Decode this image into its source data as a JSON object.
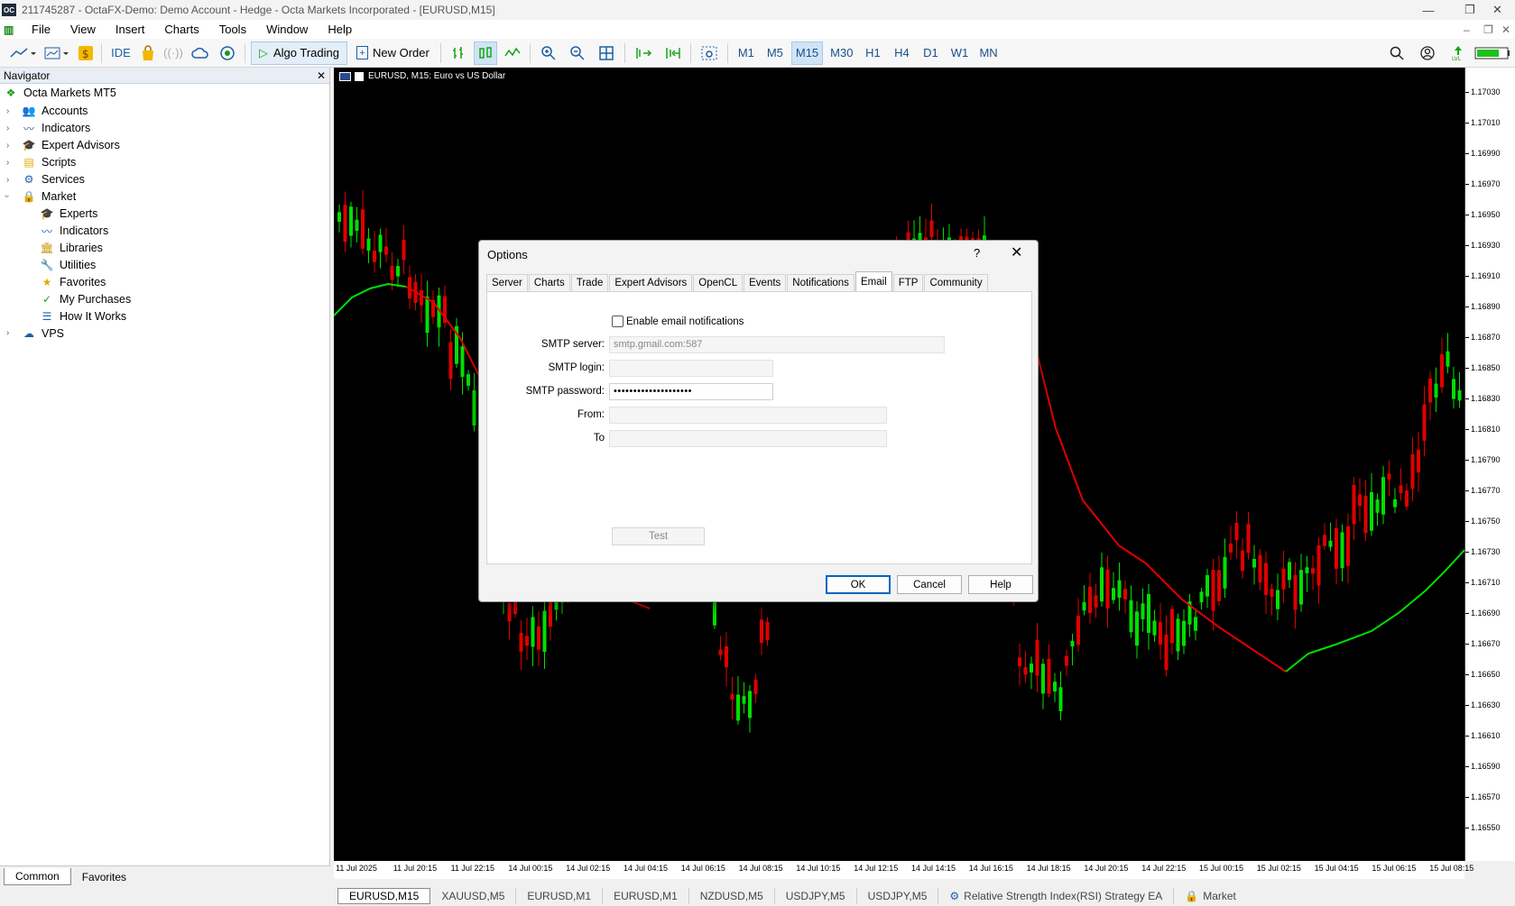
{
  "window": {
    "title": "211745287 - OctaFX-Demo: Demo Account - Hedge - Octa Markets Incorporated - [EURUSD,M15]",
    "logo_text": "OC"
  },
  "menu": [
    "File",
    "View",
    "Insert",
    "Charts",
    "Tools",
    "Window",
    "Help"
  ],
  "toolbar": {
    "ide_label": "IDE",
    "algo_label": "Algo Trading",
    "new_order_label": "New Order",
    "timeframes": [
      "M1",
      "M5",
      "M15",
      "M30",
      "H1",
      "H4",
      "D1",
      "W1",
      "MN"
    ],
    "active_timeframe": "M15"
  },
  "navigator": {
    "title": "Navigator",
    "root": "Octa Markets MT5",
    "items": [
      {
        "label": "Accounts",
        "icon": "accounts-icon"
      },
      {
        "label": "Indicators",
        "icon": "indicators-icon"
      },
      {
        "label": "Expert Advisors",
        "icon": "expert-advisors-icon"
      },
      {
        "label": "Scripts",
        "icon": "scripts-icon"
      },
      {
        "label": "Services",
        "icon": "services-icon"
      },
      {
        "label": "Market",
        "icon": "market-icon"
      }
    ],
    "market_children": [
      {
        "label": "Experts",
        "icon": "experts-icon"
      },
      {
        "label": "Indicators",
        "icon": "indicators-icon"
      },
      {
        "label": "Libraries",
        "icon": "libraries-icon"
      },
      {
        "label": "Utilities",
        "icon": "utilities-icon"
      },
      {
        "label": "Favorites",
        "icon": "favorites-icon"
      },
      {
        "label": "My Purchases",
        "icon": "purchases-icon"
      },
      {
        "label": "How It Works",
        "icon": "how-it-works-icon"
      }
    ],
    "vps": "VPS",
    "tabs": [
      "Common",
      "Favorites"
    ],
    "active_tab": "Common"
  },
  "chart": {
    "header": "EURUSD, M15:  Euro vs US Dollar",
    "price_labels": [
      "1.17030",
      "1.17010",
      "1.16990",
      "1.16970",
      "1.16950",
      "1.16930",
      "1.16910",
      "1.16890",
      "1.16870",
      "1.16850",
      "1.16830",
      "1.16810",
      "1.16790",
      "1.16770",
      "1.16750",
      "1.16730",
      "1.16710",
      "1.16690",
      "1.16670",
      "1.16650",
      "1.16630",
      "1.16610",
      "1.16590",
      "1.16570",
      "1.16550"
    ],
    "time_labels": [
      "11 Jul 2025",
      "11 Jul 20:15",
      "11 Jul 22:15",
      "14 Jul 00:15",
      "14 Jul 02:15",
      "14 Jul 04:15",
      "14 Jul 06:15",
      "14 Jul 08:15",
      "14 Jul 10:15",
      "14 Jul 12:15",
      "14 Jul 14:15",
      "14 Jul 16:15",
      "14 Jul 18:15",
      "14 Jul 20:15",
      "14 Jul 22:15",
      "15 Jul 00:15",
      "15 Jul 02:15",
      "15 Jul 04:15",
      "15 Jul 06:15",
      "15 Jul 08:15"
    ],
    "colors": {
      "bull": "#00e000",
      "bear": "#e00000",
      "ma_green": "#00e000",
      "ma_red": "#e00000"
    }
  },
  "symbol_tabs": [
    "EURUSD,M15",
    "XAUUSD,M5",
    "EURUSD,M1",
    "EURUSD,M1",
    "NZDUSD,M5",
    "USDJPY,M5",
    "USDJPY,M5",
    "Relative Strength Index(RSI) Strategy EA",
    "Market"
  ],
  "dialog": {
    "title": "Options",
    "help_glyph": "?",
    "tabs": [
      "Server",
      "Charts",
      "Trade",
      "Expert Advisors",
      "OpenCL",
      "Events",
      "Notifications",
      "Email",
      "FTP",
      "Community"
    ],
    "active_tab": "Email",
    "enable_label": "Enable email notifications",
    "enable_checked": false,
    "smtp_server_label": "SMTP server:",
    "smtp_server_value": "smtp.gmail.com:587",
    "smtp_login_label": "SMTP login:",
    "smtp_login_value": "",
    "smtp_password_label": "SMTP password:",
    "smtp_password_value": "••••••••••••••••••••",
    "from_label": "From:",
    "from_value": "",
    "to_label": "To",
    "to_value": "",
    "test_label": "Test",
    "ok_label": "OK",
    "cancel_label": "Cancel",
    "help_label": "Help"
  }
}
